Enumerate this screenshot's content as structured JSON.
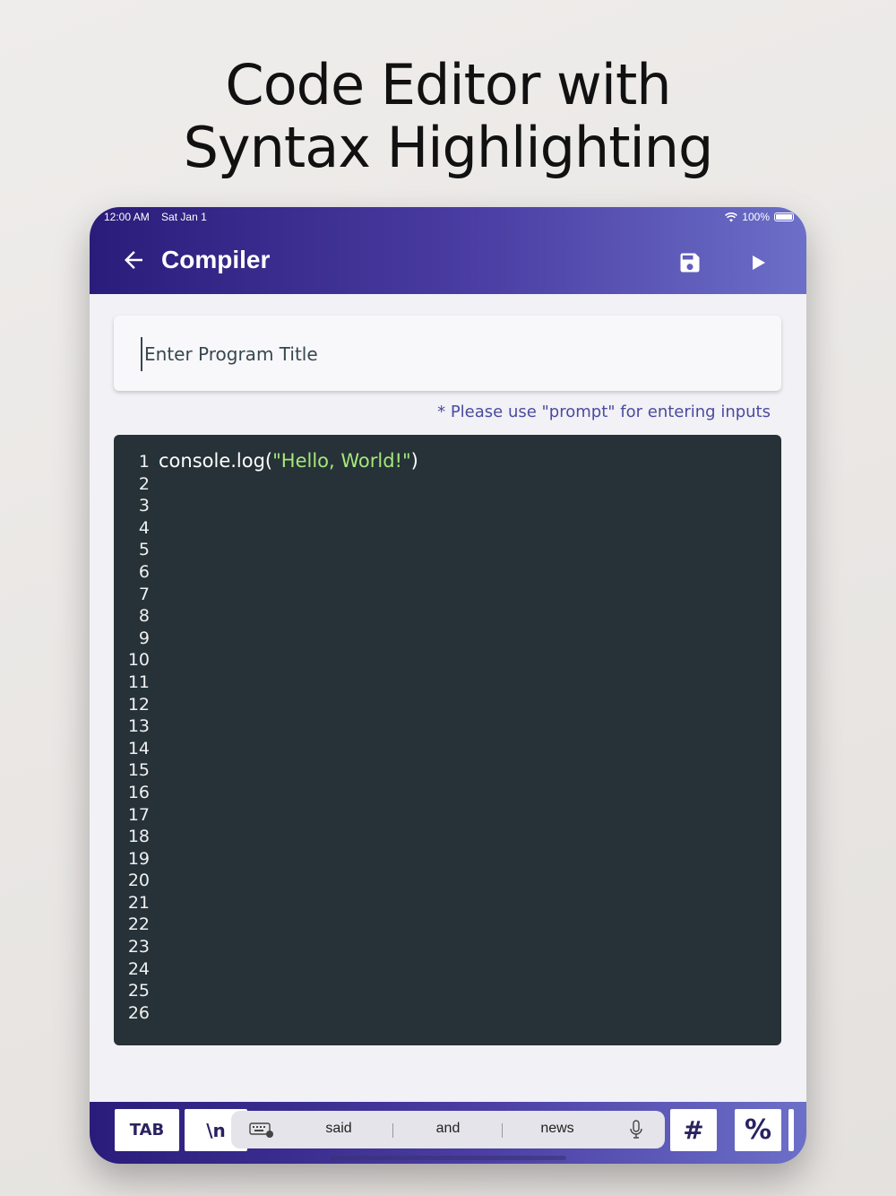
{
  "headline": {
    "line1": "Code Editor with",
    "line2": "Syntax Highlighting"
  },
  "status_bar": {
    "time": "12:00 AM",
    "date": "Sat Jan 1",
    "battery": "100%"
  },
  "appbar": {
    "title": "Compiler",
    "icons": [
      "back-arrow-icon",
      "save-icon",
      "play-icon"
    ],
    "color_start": "#2a1c7a",
    "color_end": "#6c6fc8"
  },
  "program_title": {
    "value": "",
    "placeholder": "Enter Program Title"
  },
  "hint": "* Please use \"prompt\" for entering inputs",
  "editor": {
    "background": "#263238",
    "string_color": "#a5e77a",
    "line_numbers": [
      "1",
      "2",
      "3",
      "4",
      "5",
      "6",
      "7",
      "8",
      "9",
      "10",
      "11",
      "12",
      "13",
      "14",
      "15",
      "16",
      "17",
      "18",
      "19",
      "20",
      "21",
      "22",
      "23",
      "24",
      "25",
      "26"
    ],
    "code": {
      "prefix": "console.log(",
      "string": "\"Hello, World!\"",
      "suffix": ")"
    }
  },
  "keyboard_bar": {
    "tab": "TAB",
    "newline": "\\n",
    "suggestions": [
      "said",
      "and",
      "news"
    ],
    "hash": "#",
    "percent": "%"
  }
}
